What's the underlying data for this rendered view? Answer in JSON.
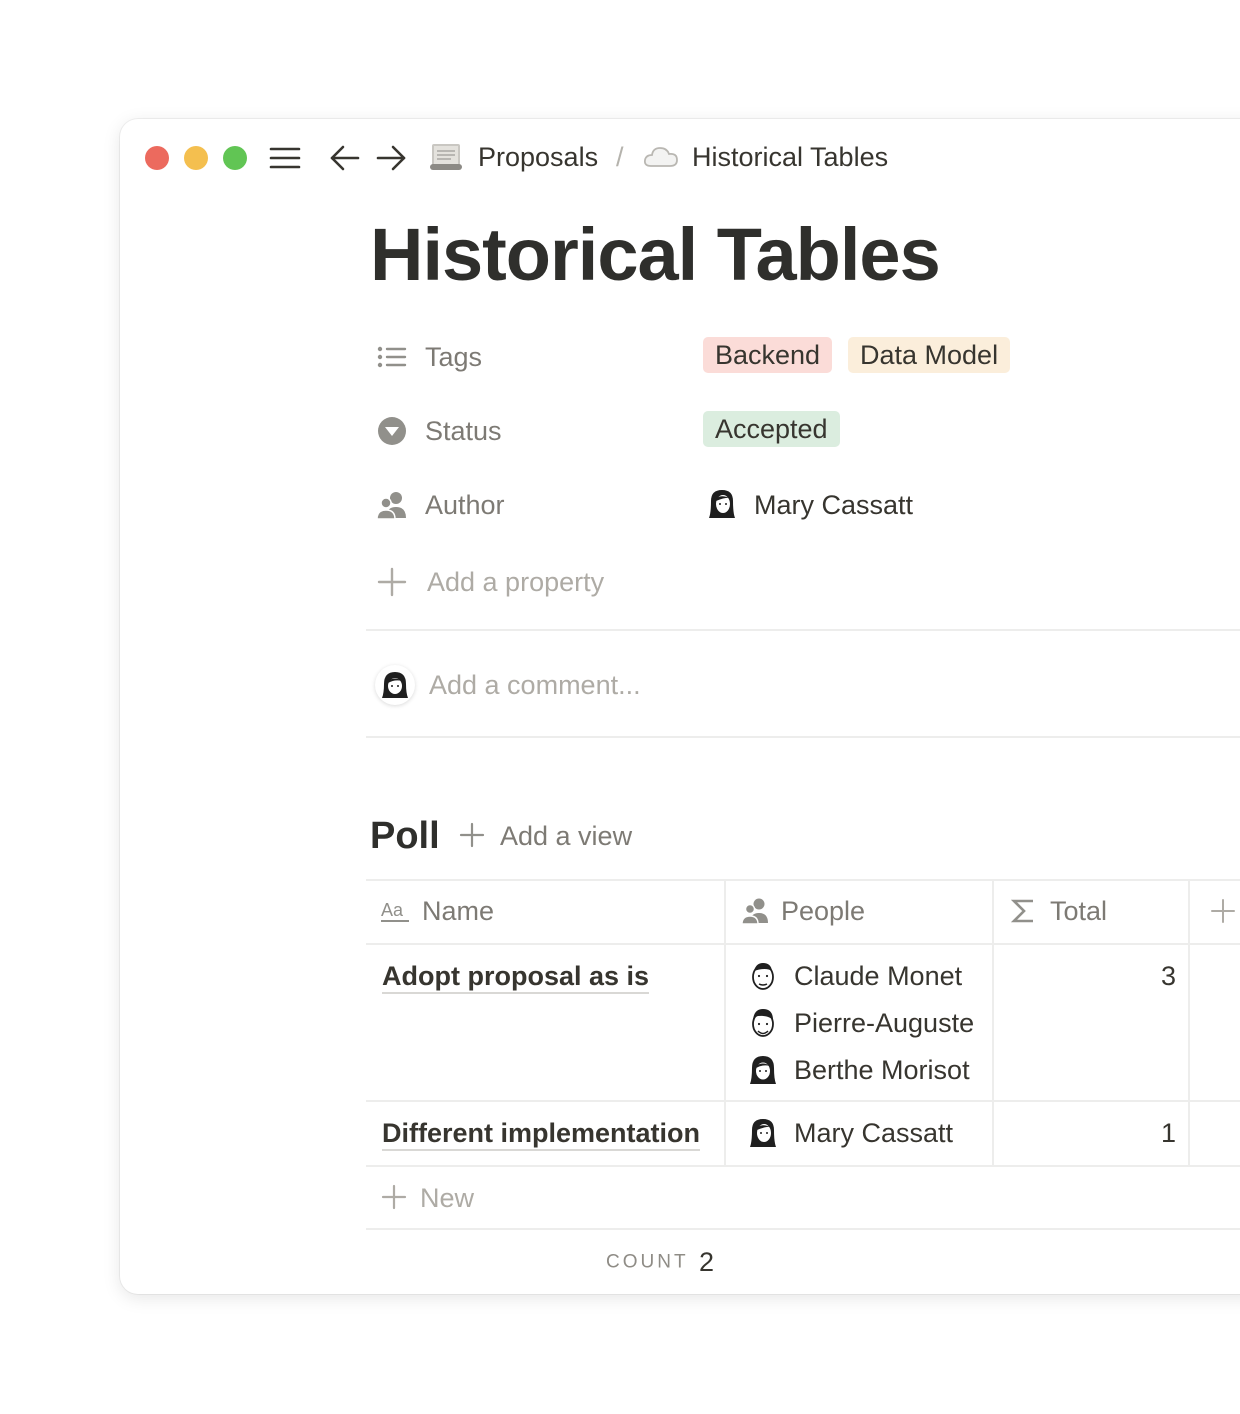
{
  "window": {
    "traffic_lights": {
      "close": "#ec6a5e",
      "minimize": "#f4bf4f",
      "zoom": "#61c554"
    },
    "toolbar_icons": [
      "menu-icon",
      "back-arrow-icon",
      "forward-arrow-icon"
    ],
    "breadcrumb": [
      {
        "icon": "scroll-emoji",
        "label": "Proposals"
      },
      {
        "icon": "cloud-emoji",
        "label": "Historical Tables"
      }
    ],
    "breadcrumb_separator": "/"
  },
  "page": {
    "title": "Historical Tables",
    "properties": {
      "tags": {
        "label": "Tags",
        "icon": "list-icon",
        "values": [
          {
            "label": "Backend",
            "color": "#fbdcd8"
          },
          {
            "label": "Data Model",
            "color": "#fbeedb"
          }
        ]
      },
      "status": {
        "label": "Status",
        "icon": "status-icon",
        "value": {
          "label": "Accepted",
          "color": "#dbeddf"
        }
      },
      "author": {
        "label": "Author",
        "icon": "person-icon",
        "value": "Mary Cassatt"
      },
      "add_property": "Add a property"
    },
    "comment": {
      "placeholder": "Add a comment..."
    }
  },
  "poll": {
    "title": "Poll",
    "add_view": "Add a view",
    "columns": [
      {
        "icon": "text-aa-icon",
        "label": "Name"
      },
      {
        "icon": "person-icon",
        "label": "People"
      },
      {
        "icon": "sigma-icon",
        "label": "Total"
      }
    ],
    "rows": [
      {
        "name": "Adopt proposal as is",
        "people": [
          "Claude Monet",
          "Pierre-Auguste",
          "Berthe Morisot"
        ],
        "total": "3"
      },
      {
        "name": "Different implementation",
        "people": [
          "Mary Cassatt"
        ],
        "total": "1"
      }
    ],
    "new_label": "New",
    "count_label": "COUNT",
    "count_value": "2"
  }
}
